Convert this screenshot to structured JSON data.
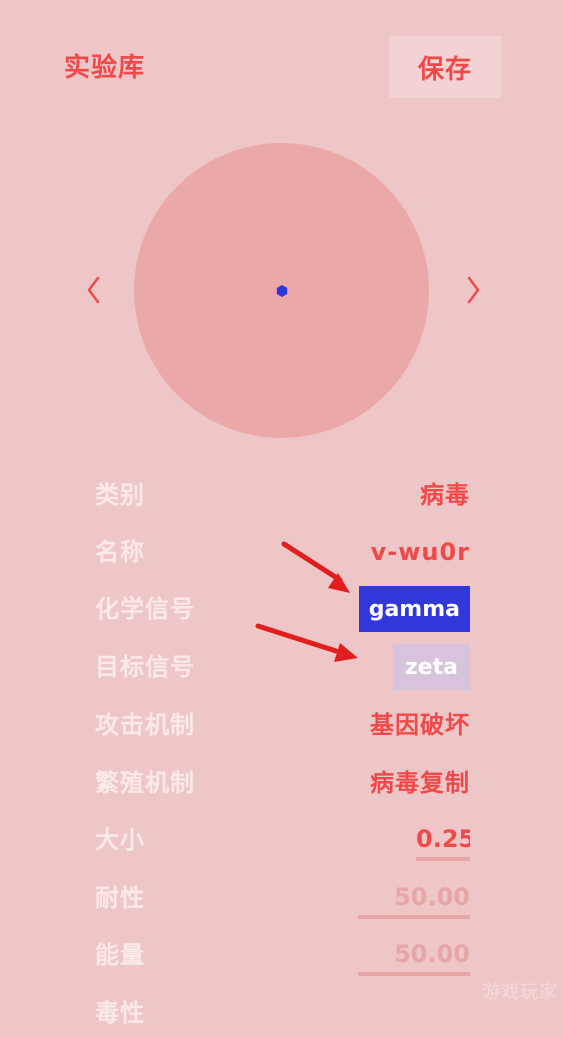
{
  "header": {
    "title": "实验库",
    "save_label": "保存"
  },
  "icons": {
    "prev": "chevron-left-icon",
    "next": "chevron-right-icon"
  },
  "colors": {
    "background": "#efc6c7",
    "accent": "#ef4a4a",
    "specimen": "#eaa9a8",
    "gamma_chip": "#3137d8",
    "zeta_chip": "#d8c3dc",
    "annotation_arrow": "#e11d1d"
  },
  "properties": {
    "category": {
      "label": "类别",
      "value": "病毒"
    },
    "name": {
      "label": "名称",
      "value": "v-wu0r"
    },
    "chemical_signal": {
      "label": "化学信号",
      "value": "gamma"
    },
    "target_signal": {
      "label": "目标信号",
      "value": "zeta"
    },
    "attack": {
      "label": "攻击机制",
      "value": "基因破坏"
    },
    "reproduction": {
      "label": "繁殖机制",
      "value": "病毒复制"
    },
    "size": {
      "label": "大小",
      "value": "0.25"
    },
    "durability": {
      "label": "耐性",
      "value": "50.00"
    },
    "energy": {
      "label": "能量",
      "value": "50.00"
    },
    "partial_next": {
      "label": "毒性"
    }
  },
  "watermark": "游戏玩家"
}
